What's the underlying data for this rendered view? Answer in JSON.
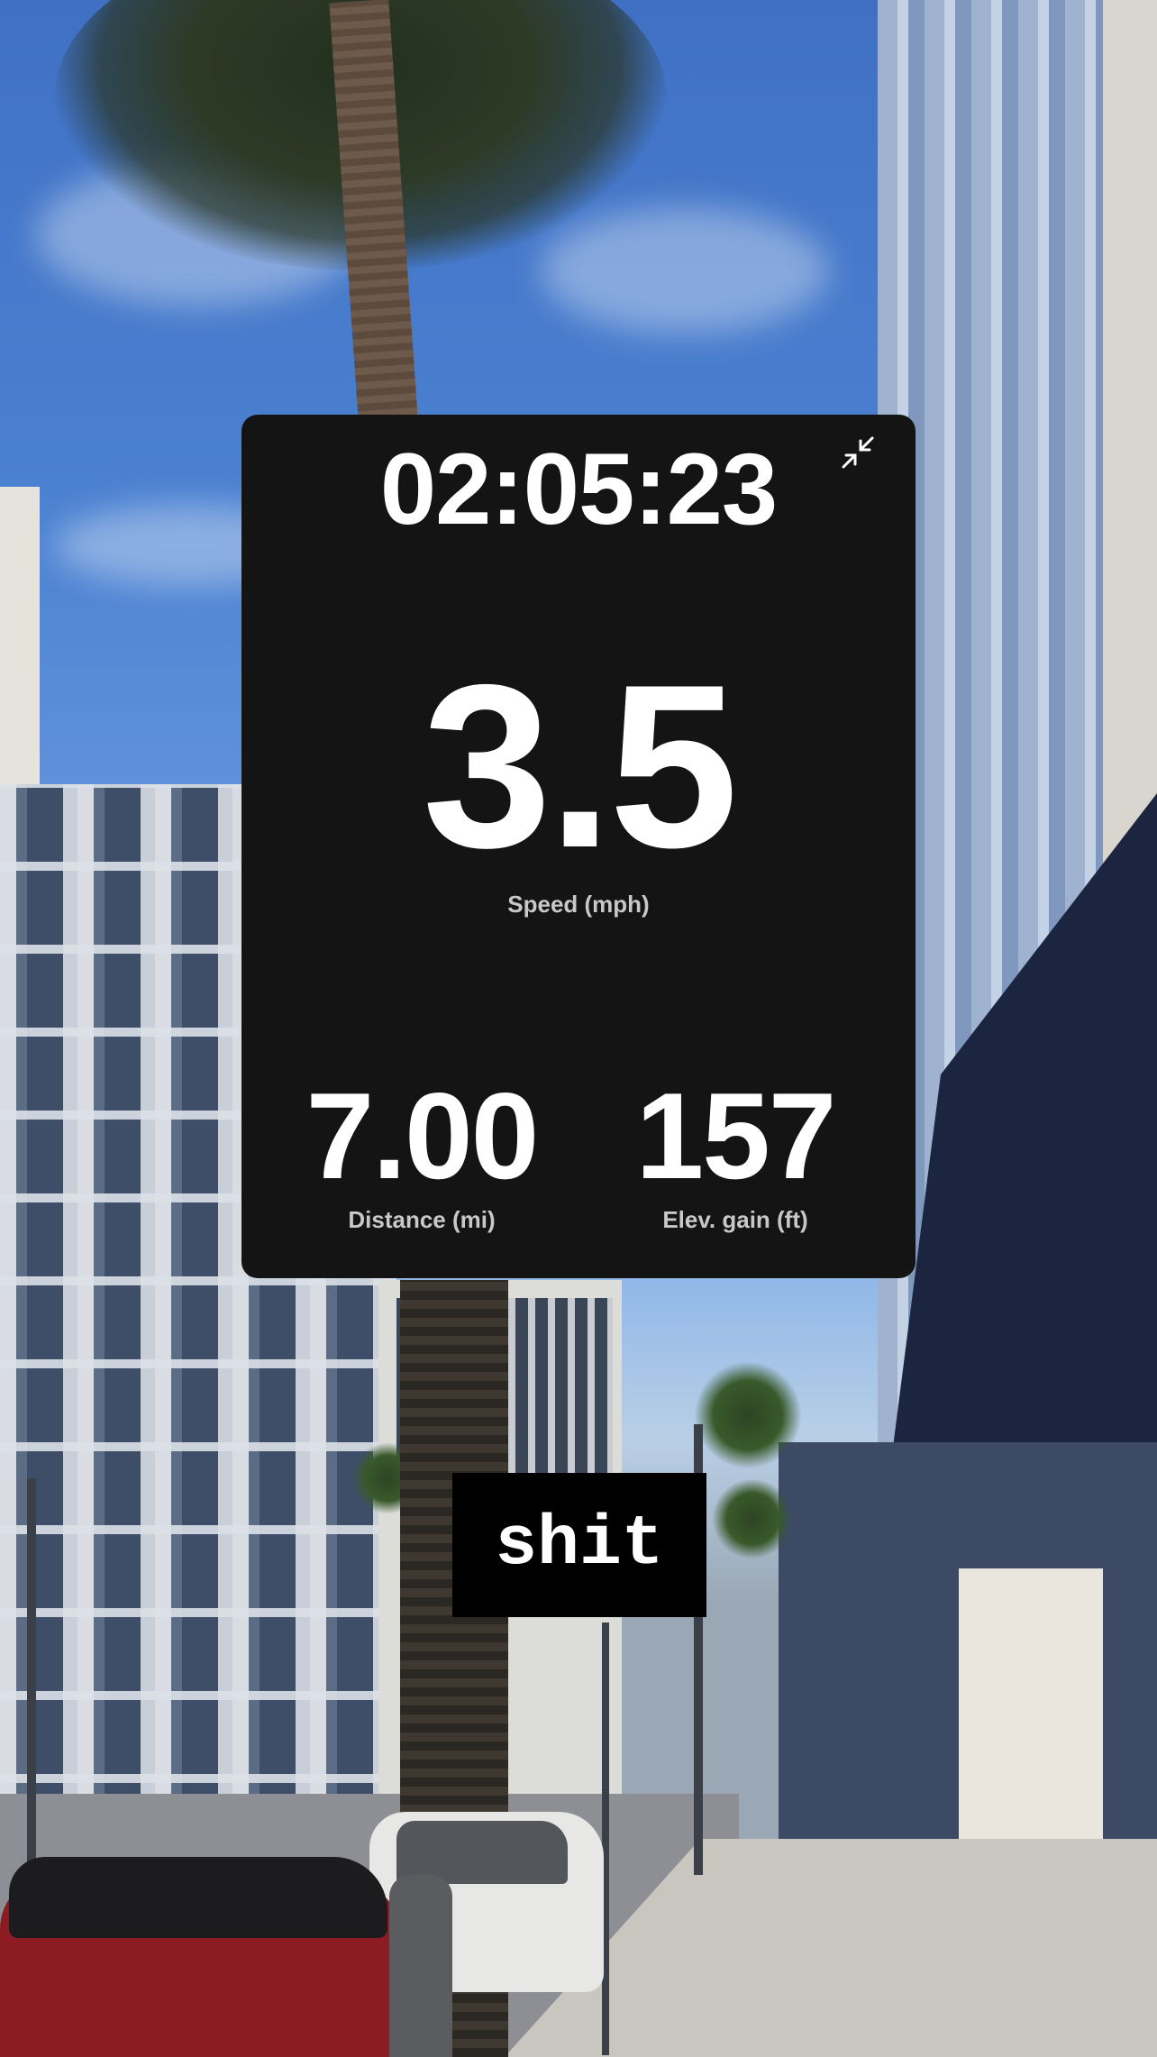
{
  "workout": {
    "elapsed_time": "02:05:23",
    "speed": {
      "value": "3.5",
      "label": "Speed (mph)"
    },
    "distance": {
      "value": "7.00",
      "label": "Distance (mi)"
    },
    "elevation_gain": {
      "value": "157",
      "label": "Elev. gain (ft)"
    },
    "collapse_icon": "collapse-arrows-icon"
  },
  "caption": {
    "text": "shit"
  },
  "colors": {
    "card_background": "#141414",
    "primary_text": "#ffffff",
    "secondary_text": "#c8c8c8",
    "caption_background": "#000000"
  }
}
